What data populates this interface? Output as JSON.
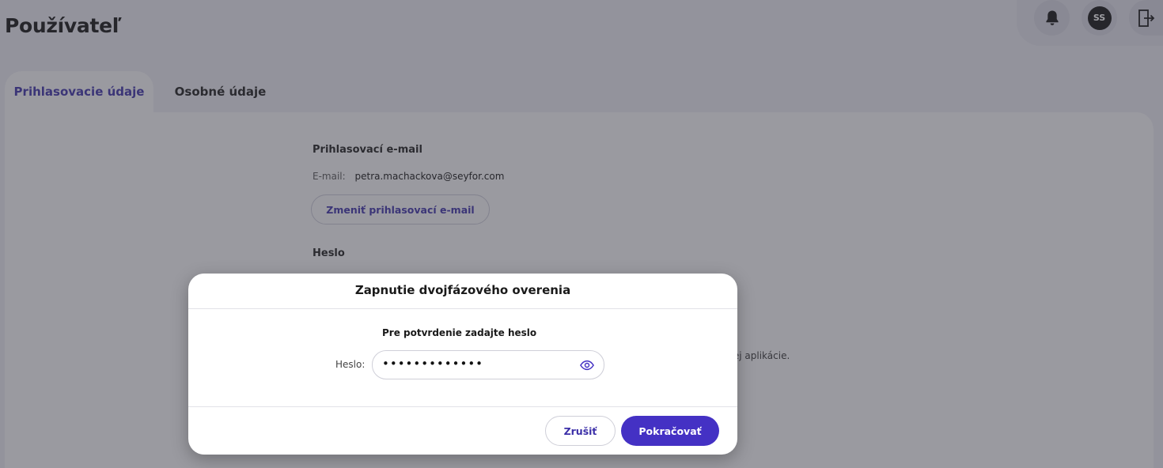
{
  "page": {
    "title": "Používateľ"
  },
  "header": {
    "avatar_initials": "SS",
    "icons": [
      "bell-icon",
      "avatar",
      "logout-icon"
    ]
  },
  "tabs": [
    {
      "label": "Prihlasovacie údaje",
      "active": true
    },
    {
      "label": "Osobné údaje",
      "active": false
    }
  ],
  "login": {
    "email_section_title": "Prihlasovací e-mail",
    "email_label": "E-mail:",
    "email_value": "petra.machackova@seyfor.com",
    "change_email_button": "Zmeniť prihlasovací e-mail",
    "password_section_title": "Heslo",
    "partial_text": "bilnej aplikácie."
  },
  "modal": {
    "title": "Zapnutie dvojfázového overenia",
    "prompt": "Pre potvrdenie zadajte heslo",
    "password_label": "Heslo:",
    "password_value": "•••••••••••••",
    "cancel_button": "Zrušiť",
    "continue_button": "Pokračovať"
  },
  "colors": {
    "accent": "#4431c4",
    "accent_text": "#3b2fa8",
    "page_bg": "#ebebf2",
    "panel_bg": "#f8f8fb"
  }
}
